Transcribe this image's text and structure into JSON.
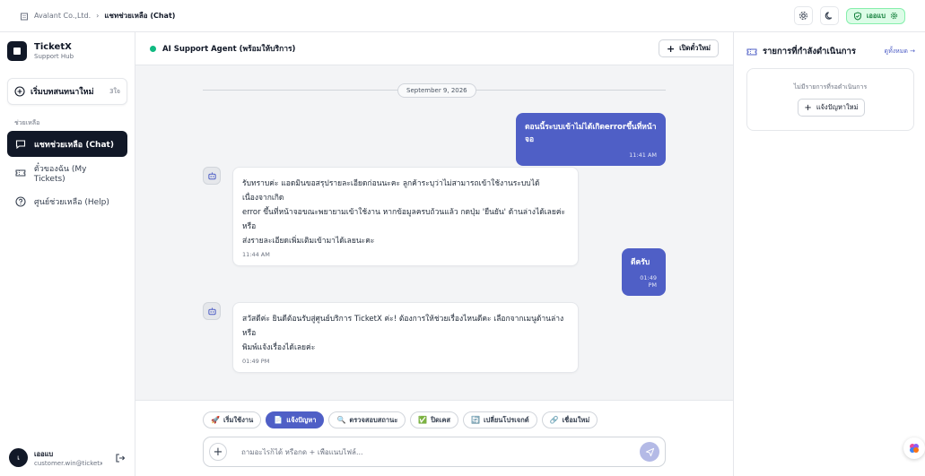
{
  "breadcrumb": {
    "company": "Avalant Co.,Ltd.",
    "current": "แชทช่วยเหลือ (Chat)"
  },
  "topbar": {
    "status_label": "เออแบ"
  },
  "brand": {
    "name": "TicketX",
    "subtitle": "Support Hub"
  },
  "sidebar": {
    "new_chat_label": "เริ่มบทสนทนาใหม่",
    "new_chat_hint": "3ใจ",
    "section_label": "ช่วยเหลือ",
    "items": [
      {
        "label": "แชทช่วยเหลือ (Chat)",
        "icon": "chat-icon",
        "active": true
      },
      {
        "label": "ตั๋วของฉัน (My Tickets)",
        "icon": "ticket-icon",
        "active": false
      },
      {
        "label": "ศูนย์ช่วยเหลือ (Help)",
        "icon": "help-icon",
        "active": false
      }
    ]
  },
  "user": {
    "initial": "เ",
    "name": "เออแบ",
    "email": "customer.win@ticketx.com"
  },
  "chat": {
    "agent_name": "AI Support Agent (พร้อมให้บริการ)",
    "open_ticket_label": "เปิดตั๋วใหม่",
    "date": "September 9, 2026",
    "messages": [
      {
        "role": "user",
        "text": "ตอนนี้ระบบเข้าไม่ได้เกิดerrorขึ้นที่หน้าจอ",
        "time": "11:41 AM"
      },
      {
        "role": "bot",
        "lines": [
          "รับทราบค่ะ แอดมินขอสรุปรายละเอียดก่อนนะคะ ลูกค้าระบุว่าไม่สามารถเข้าใช้งานระบบได้เนื่องจากเกิด",
          "error ขึ้นที่หน้าจอขณะพยายามเข้าใช้งาน หากข้อมูลครบถ้วนแล้ว กดปุ่ม 'ยืนยัน' ด้านล่างได้เลยค่ะ หรือ",
          "ส่งรายละเอียดเพิ่มเติมเข้ามาได้เลยนะคะ"
        ],
        "time": "11:44 AM"
      },
      {
        "role": "user",
        "text": "ดีครับ",
        "time": "01:49 PM"
      },
      {
        "role": "bot",
        "lines": [
          "สวัสดีค่ะ ยินดีต้อนรับสู่ศูนย์บริการ TicketX ค่ะ! ต้องการให้ช่วยเรื่องไหนดีคะ เลือกจากเมนูด้านล่าง หรือ",
          "พิมพ์แจ้งเรื่องได้เลยค่ะ"
        ],
        "time": "01:49 PM"
      }
    ]
  },
  "composer": {
    "chips": [
      {
        "emoji": "🚀",
        "label": "เริ่มใช้งาน",
        "active": false
      },
      {
        "emoji": "📄",
        "label": "แจ้งปัญหา",
        "active": true
      },
      {
        "emoji": "🔍",
        "label": "ตรวจสอบสถานะ",
        "active": false
      },
      {
        "emoji": "✅",
        "label": "ปิดเคส",
        "active": false
      },
      {
        "emoji": "🔄",
        "label": "เปลี่ยนโปรเจกต์",
        "active": false
      },
      {
        "emoji": "🔗",
        "label": "เชื่อมใหม่",
        "active": false
      }
    ],
    "placeholder": "ถามอะไรก็ได้ หรือกด + เพื่อแนบไฟล์..."
  },
  "right_panel": {
    "title": "รายการที่กำลังดำเนินการ",
    "link": "ดูทั้งหมด",
    "empty_text": "ไม่มีรายการที่รอดำเนินการ",
    "button_label": "แจ้งปัญหาใหม่"
  },
  "colors": {
    "accent": "#4f5fc6",
    "dark": "#111827",
    "online": "#10b981"
  }
}
